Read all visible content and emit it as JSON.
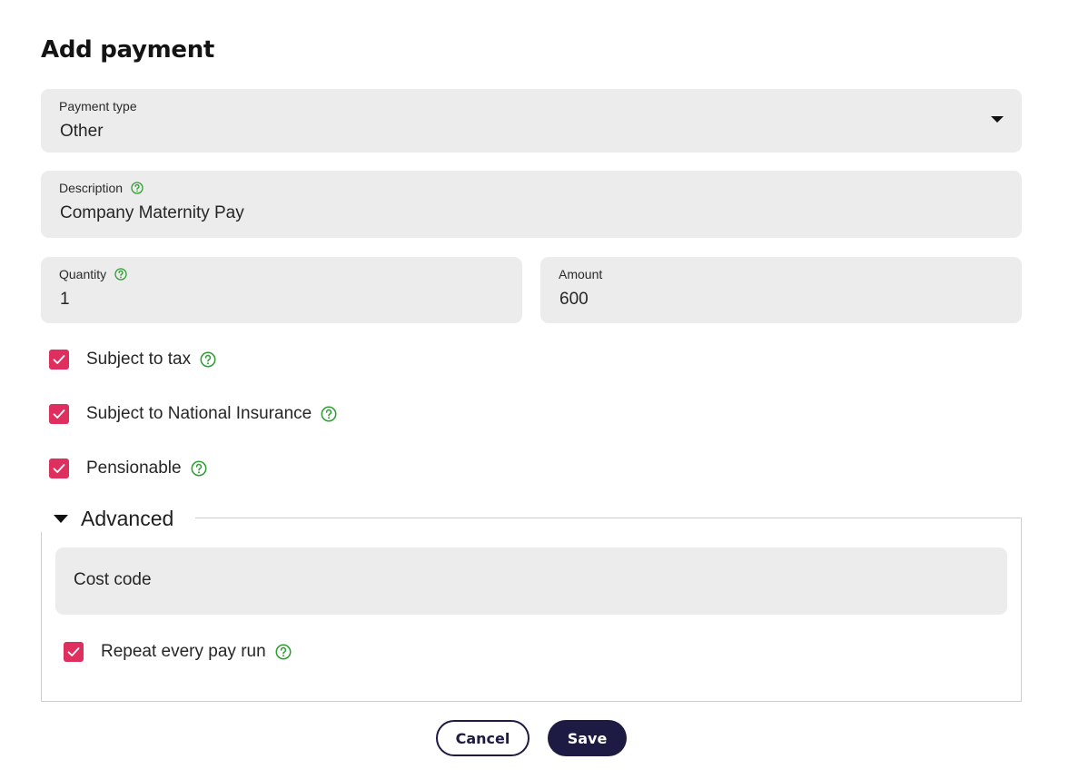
{
  "page": {
    "title": "Add payment"
  },
  "payment_type": {
    "label": "Payment type",
    "value": "Other"
  },
  "description": {
    "label": "Description",
    "value": "Company Maternity Pay"
  },
  "quantity": {
    "label": "Quantity",
    "value": "1"
  },
  "amount": {
    "label": "Amount",
    "value": "600"
  },
  "checkboxes": [
    {
      "label": "Subject to tax",
      "checked": true
    },
    {
      "label": "Subject to National Insurance",
      "checked": true
    },
    {
      "label": "Pensionable",
      "checked": true
    }
  ],
  "advanced": {
    "label": "Advanced",
    "cost_code": {
      "placeholder": "Cost code"
    },
    "repeat": {
      "label": "Repeat every pay run",
      "checked": true
    }
  },
  "buttons": {
    "cancel": "Cancel",
    "save": "Save"
  },
  "colors": {
    "checkbox": "#de2f5f",
    "help_icon": "#2e9e32",
    "primary": "#1d1a44",
    "field_bg": "#ececec"
  },
  "icons": {
    "help": "question-circle-icon",
    "dropdown": "caret-down-icon",
    "check": "checkmark-icon",
    "collapse": "triangle-down-icon"
  }
}
